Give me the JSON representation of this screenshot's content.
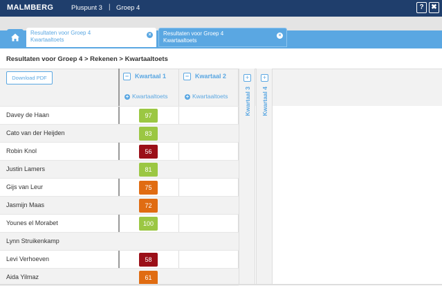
{
  "topbar": {
    "brand": "MALMBERG",
    "method": "Pluspunt 3",
    "separator": "|",
    "group": "Groep 4",
    "help_label": "?",
    "close_label": "✖"
  },
  "tabs": [
    {
      "line1": "Resultaten voor Groep 4",
      "line2": "Kwartaaltoets",
      "active": true
    },
    {
      "line1": "Resultaten voor Groep 4",
      "line2": "Kwartaaltoets",
      "active": false
    }
  ],
  "breadcrumb": "Resultaten voor Groep 4 > Rekenen > Kwartaaltoets",
  "download_label": "Download PDF",
  "quarters": [
    {
      "label": "Kwartaal 1",
      "add_label": "Kwartaaltoets",
      "toggle": "−"
    },
    {
      "label": "Kwartaal 2",
      "add_label": "Kwartaaltoets",
      "toggle": "−"
    },
    {
      "label": "Kwartaal 3",
      "toggle": "+"
    },
    {
      "label": "Kwartaal 4",
      "toggle": "+"
    }
  ],
  "colors": {
    "green": "#9bc743",
    "orange": "#e06c12",
    "red": "#9b0f18"
  },
  "students": [
    {
      "name": "Davey de Haan",
      "score": "97",
      "level": "green"
    },
    {
      "name": "Cato van der Heijden",
      "score": "83",
      "level": "green"
    },
    {
      "name": "Robin Knol",
      "score": "56",
      "level": "red"
    },
    {
      "name": "Justin Lamers",
      "score": "81",
      "level": "green"
    },
    {
      "name": "Gijs van Leur",
      "score": "75",
      "level": "orange"
    },
    {
      "name": "Jasmijn Maas",
      "score": "72",
      "level": "orange"
    },
    {
      "name": "Younes el Morabet",
      "score": "100",
      "level": "green"
    },
    {
      "name": "Lynn Struikenkamp",
      "score": "",
      "level": ""
    },
    {
      "name": "Levi Verhoeven",
      "score": "58",
      "level": "red"
    },
    {
      "name": "Aida Yilmaz",
      "score": "61",
      "level": "orange"
    }
  ]
}
